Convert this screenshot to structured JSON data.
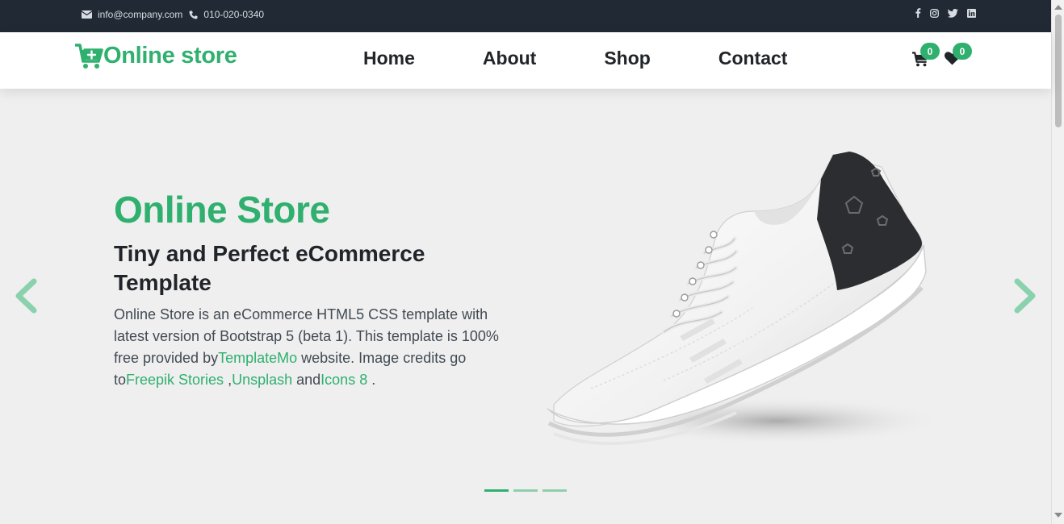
{
  "topbar": {
    "email": "info@company.com",
    "phone": "010-020-0340",
    "social": [
      "facebook-icon",
      "instagram-icon",
      "twitter-icon",
      "linkedin-icon"
    ]
  },
  "nav": {
    "brand": "Online store",
    "links": [
      "Home",
      "About",
      "Shop",
      "Contact"
    ],
    "cart_count": "0",
    "wishlist_count": "0"
  },
  "hero": {
    "title": "Online Store",
    "subtitle": "Tiny and Perfect eCommerce Template",
    "description_1": "Online Store is an eCommerce HTML5 CSS template with latest version of Bootstrap 5 (beta 1). This template is 100% free provided by",
    "link_templatemo": "TemplateMo",
    "description_2": " website. Image credits go to",
    "link_freepik": "Freepik Stories",
    "description_3": " ,",
    "link_unsplash": "Unsplash",
    "description_4": " and",
    "link_icons8": "Icons 8",
    "description_5": " .",
    "slides_total": 3,
    "active_slide": 1
  },
  "colors": {
    "accent": "#2fb06e",
    "topbar_bg": "#212934",
    "hero_bg": "#efefef",
    "heading": "#212529"
  }
}
